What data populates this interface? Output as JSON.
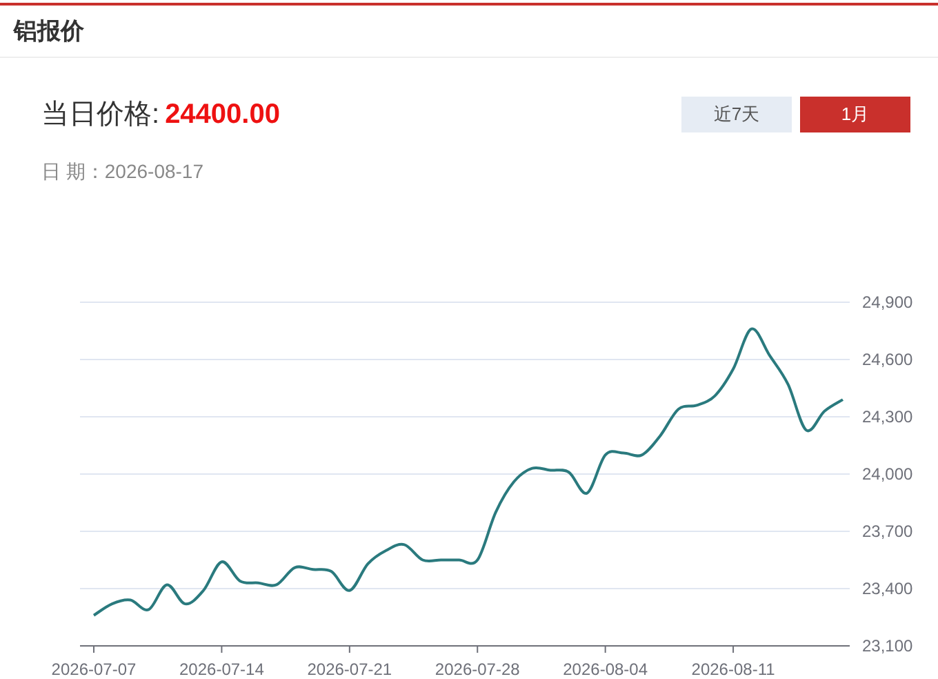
{
  "title": "铝报价",
  "price": {
    "label": "当日价格:",
    "value": "24400.00"
  },
  "date": {
    "label": "日 期：",
    "value": "2026-08-17"
  },
  "ranges": [
    {
      "label": "近7天",
      "selected": false
    },
    {
      "label": "1月",
      "selected": true
    }
  ],
  "chart_data": {
    "type": "line",
    "grid": true,
    "categories": [
      "2026-07-07",
      null,
      null,
      null,
      null,
      null,
      null,
      "2026-07-14",
      null,
      null,
      null,
      null,
      null,
      null,
      "2026-07-21",
      null,
      null,
      null,
      null,
      null,
      null,
      "2026-07-28",
      null,
      null,
      null,
      null,
      null,
      null,
      "2026-08-04",
      null,
      null,
      null,
      null,
      null,
      null,
      "2026-08-11",
      null,
      null,
      null,
      null,
      null,
      null
    ],
    "series": [
      {
        "color": "#2a7a7e",
        "values": [
          23260,
          23320,
          23340,
          23290,
          23420,
          23320,
          23390,
          23540,
          23440,
          23430,
          23420,
          23510,
          23500,
          23490,
          23390,
          23530,
          23600,
          23630,
          23550,
          23550,
          23550,
          23550,
          23800,
          23960,
          24030,
          24020,
          24010,
          23900,
          24100,
          24110,
          24100,
          24200,
          24340,
          24360,
          24410,
          24550,
          24760,
          24620,
          24470,
          24230,
          24330,
          24390
        ]
      }
    ],
    "ylim": [
      23100,
      24900
    ],
    "yticks": [
      {
        "value": 23100,
        "label": "23,100"
      },
      {
        "value": 23400,
        "label": "23,400"
      },
      {
        "value": 23700,
        "label": "23,700"
      },
      {
        "value": 24000,
        "label": "24,000"
      },
      {
        "value": 24300,
        "label": "24,300"
      },
      {
        "value": 24600,
        "label": "24,600"
      },
      {
        "value": 24900,
        "label": "24,900"
      }
    ]
  }
}
